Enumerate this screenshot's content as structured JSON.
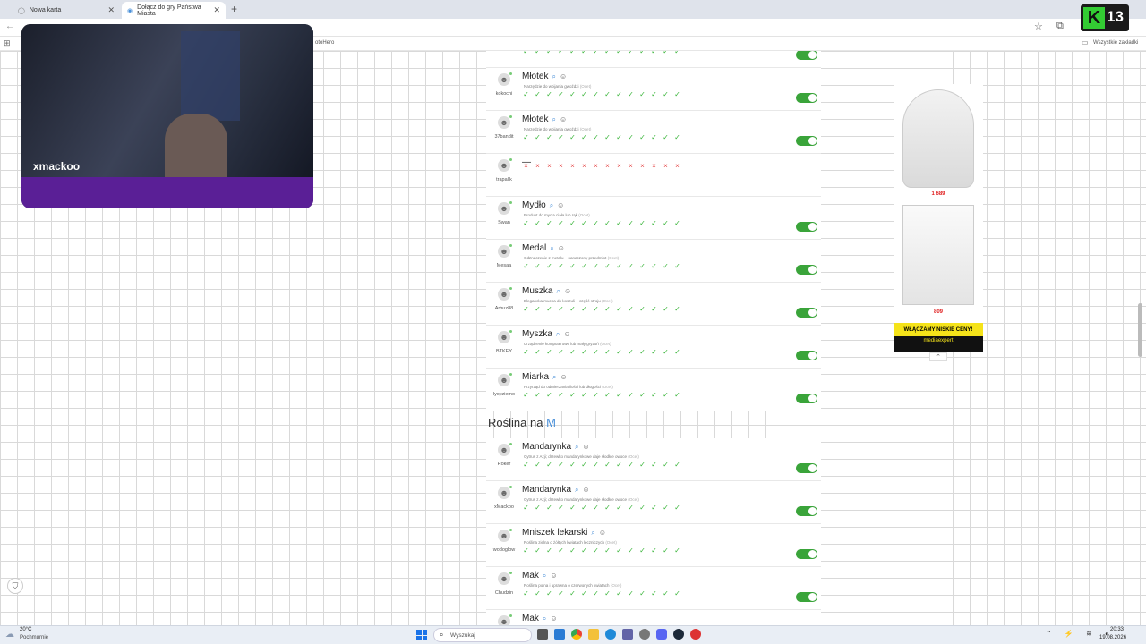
{
  "browser": {
    "tabs": [
      {
        "label": "Nowa karta"
      },
      {
        "label": "Dołącz do gry Państwa Miasta"
      }
    ],
    "bookmarks_right": "Wszystkie zakładki",
    "bookmark_partial": "otoHero"
  },
  "stream": {
    "streamer_name": "xmackoo",
    "badge_number": "13"
  },
  "entries_top": [
    {
      "word": "Młotek",
      "user": "kokochi",
      "desc": "Narzędzie do wbijania gwoździ",
      "tag": "(Ocet)",
      "votes": "ok",
      "toggle": true
    },
    {
      "word": "Młotek",
      "user": "37bandit",
      "desc": "Narzędzie do wbijania gwoździ",
      "tag": "(Ocet)",
      "votes": "ok",
      "toggle": true
    },
    {
      "word": "—",
      "user": "trapalik",
      "desc": "",
      "tag": "",
      "votes": "bad",
      "toggle": false
    },
    {
      "word": "Mydło",
      "user": "Swan",
      "desc": "Produkt do mycia ciała lub rąk",
      "tag": "(Ocet)",
      "votes": "ok",
      "toggle": true
    },
    {
      "word": "Medal",
      "user": "Mesaa",
      "desc": "Odznaczenie z metalu – nanaczony przedmiot",
      "tag": "(Ocet)",
      "votes": "ok",
      "toggle": true
    },
    {
      "word": "Muszka",
      "user": "Arbuz88",
      "desc": "Elegancka mucha do koszuli – część stroju",
      "tag": "(Ocet)",
      "votes": "ok",
      "toggle": true
    },
    {
      "word": "Myszka",
      "user": "BTKEY",
      "desc": "Urządzenie komputerowe lub mały gryzoń",
      "tag": "(Ocet)",
      "votes": "ok",
      "toggle": true
    },
    {
      "word": "Miarka",
      "user": "lysyziemo",
      "desc": "Przyrząd do odmierzania ilości lub długości",
      "tag": "(Ocet)",
      "votes": "ok",
      "toggle": true
    }
  ],
  "section": {
    "label": "Roślina na",
    "letter": "M"
  },
  "entries_bottom": [
    {
      "word": "Mandarynka",
      "user": "Roker",
      "desc": "Cytrus z Azji; drzewko mandarynkowe daje słodkie owoce",
      "tag": "(Ocet)",
      "votes": "ok",
      "toggle": true
    },
    {
      "word": "Mandarynka",
      "user": "xMackoo",
      "desc": "Cytrus z Azji; drzewko mandarynkowe daje słodkie owoce",
      "tag": "(Ocet)",
      "votes": "ok",
      "toggle": true
    },
    {
      "word": "Mniszek lekarski",
      "user": "wodoglow",
      "desc": "Roślina zielna o żółtych kwiatach leczniczych",
      "tag": "(Ocet)",
      "votes": "ok",
      "toggle": true
    },
    {
      "word": "Mak",
      "user": "Chudzin",
      "desc": "Roślina polna i uprawna o czerwonych kwiatach",
      "tag": "(Ocet)",
      "votes": "ok",
      "toggle": true
    },
    {
      "word": "Mak",
      "user": "",
      "desc": "",
      "tag": "",
      "votes": "none",
      "toggle": false
    }
  ],
  "ad": {
    "price1": "1 689",
    "price2": "809",
    "banner": "WŁĄCZAMY NISKIE CENY!",
    "brand": "mediaexpert"
  },
  "taskbar": {
    "weather_temp": "20°C",
    "weather_desc": "Pochmurnie",
    "search_placeholder": "Wyszukaj",
    "time": "20:33",
    "date": "19.08.2026"
  }
}
